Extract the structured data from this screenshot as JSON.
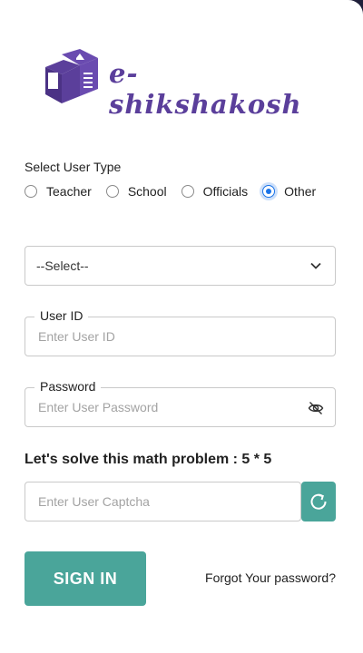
{
  "brand": {
    "name": "e-shikshakosh"
  },
  "user_type": {
    "label": "Select User Type",
    "options": [
      "Teacher",
      "School",
      "Officials",
      "Other"
    ],
    "selected": "Other"
  },
  "select": {
    "value": "--Select--"
  },
  "user_id": {
    "label": "User ID",
    "placeholder": "Enter User ID"
  },
  "password": {
    "label": "Password",
    "placeholder": "Enter User Password"
  },
  "captcha": {
    "question": "Let's solve this math problem : 5 * 5",
    "placeholder": "Enter User Captcha"
  },
  "actions": {
    "sign_in": "SIGN IN",
    "forgot": "Forgot Your password?"
  },
  "colors": {
    "brand": "#5b3f9b",
    "accent": "#4aa59a",
    "radio_selected": "#1a73e8"
  }
}
